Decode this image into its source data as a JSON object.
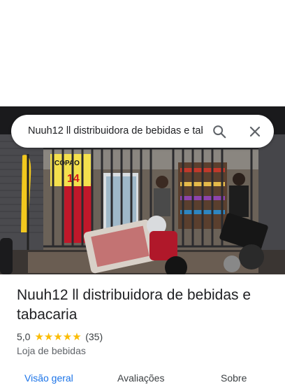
{
  "search": {
    "value": "Nuuh12 ll distribuidora de bebidas e tabacaria",
    "search_icon": "search-icon",
    "close_icon": "close-icon"
  },
  "photo": {
    "sign_top": "COPAO",
    "sign_price": "14"
  },
  "place": {
    "title": "Nuuh12 ll distribuidora de bebidas e tabacaria",
    "rating": "5,0",
    "stars": "★★★★★",
    "review_count": "(35)",
    "category": "Loja de bebidas"
  },
  "tabs": [
    {
      "label": "Visão geral",
      "active": true
    },
    {
      "label": "Avaliações",
      "active": false
    },
    {
      "label": "Sobre",
      "active": false
    }
  ],
  "colors": {
    "accent": "#1a73e8",
    "star": "#fbbc04",
    "text_primary": "#202124",
    "text_secondary": "#5f6368"
  }
}
